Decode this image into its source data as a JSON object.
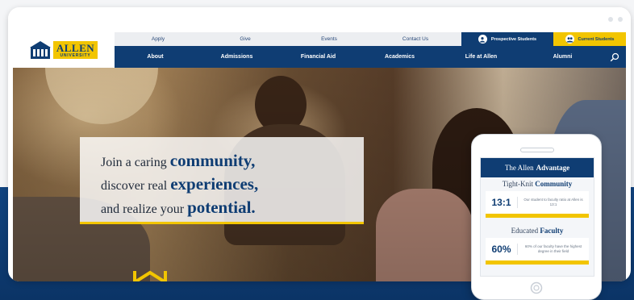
{
  "logo": {
    "name": "ALLEN",
    "sub": "UNIVERSITY"
  },
  "utility_nav": {
    "items": [
      "Apply",
      "Give",
      "Events",
      "Contact Us"
    ],
    "prospective": "Prospective Students",
    "current": "Current Students"
  },
  "main_nav": {
    "items": [
      "About",
      "Admissions",
      "Financial Aid",
      "Academics",
      "Life at Allen",
      "Alumni"
    ]
  },
  "hero": {
    "line1_pre": "Join a caring ",
    "line1_strong": "community",
    "line1_post": ",",
    "line2_pre": "discover real ",
    "line2_strong": "experiences",
    "line2_post": ",",
    "line3_pre": "and realize your ",
    "line3_strong": "potential",
    "line3_post": "."
  },
  "phone": {
    "advantage_pre": "The Allen",
    "advantage_strong": "Advantage",
    "community_pre": "Tight-Knit",
    "community_strong": "Community",
    "ratio_value": "13:1",
    "ratio_desc": "Our student to faculty ratio at Allen is 13:1",
    "faculty_pre": "Educated",
    "faculty_strong": "Faculty",
    "faculty_value": "60%",
    "faculty_desc": "60% of our faculty have the highest degree in their field"
  },
  "colors": {
    "brand_navy": "#0f3d73",
    "brand_gold": "#f2c500"
  },
  "icons": [
    "search-icon",
    "user-icon",
    "users-icon",
    "building-icon",
    "chevron-icon",
    "home-button-icon"
  ]
}
